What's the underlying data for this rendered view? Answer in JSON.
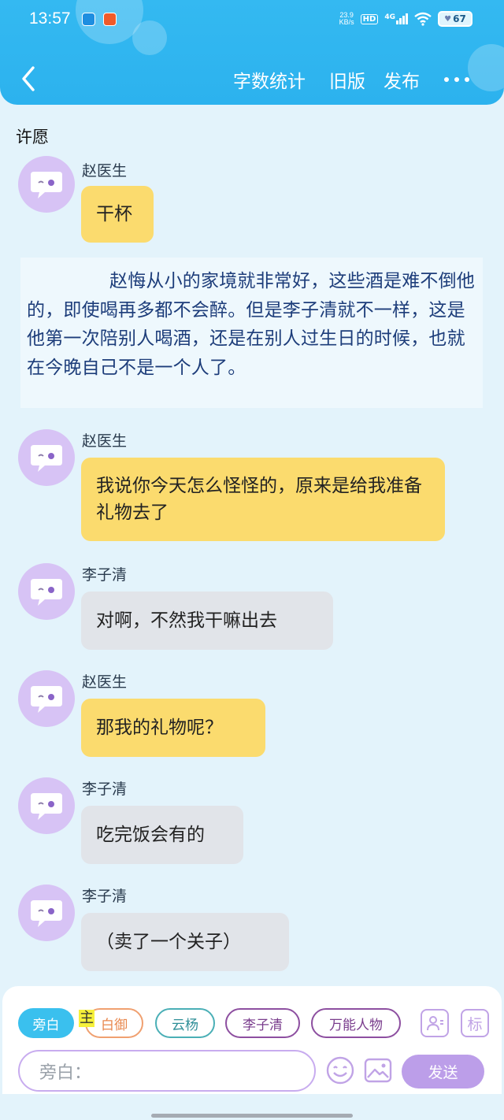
{
  "status_bar": {
    "time": "13:57",
    "net_speed_value": "23.9",
    "net_speed_unit": "KB/s",
    "hd": "HD",
    "network": "4G",
    "battery": "67"
  },
  "nav": {
    "word_count": "字数统计",
    "old_version": "旧版",
    "publish": "发布"
  },
  "novel_title": "许愿",
  "messages": [
    {
      "sender": "赵医生",
      "text": "干杯",
      "style": "yellow"
    },
    {
      "sender": "赵医生",
      "text": "我说你今天怎么怪怪的，原来是给我准备礼物去了",
      "style": "yellow"
    },
    {
      "sender": "李子清",
      "text": "对啊，不然我干嘛出去",
      "style": "gray"
    },
    {
      "sender": "赵医生",
      "text": "那我的礼物呢？",
      "style": "yellow"
    },
    {
      "sender": "李子清",
      "text": "吃完饭会有的",
      "style": "gray"
    },
    {
      "sender": "李子清",
      "text": "（卖了一个关子）",
      "style": "gray"
    }
  ],
  "narration": "赵悔从小的家境就非常好，这些酒是难不倒他的，即使喝再多都不会醉。但是李子清就不一样，这是他第一次陪别人喝酒，还是在别人过生日的时候，也就在今晚自己不是一个人了。",
  "composer": {
    "roles": [
      "旁白",
      "白御",
      "云杨",
      "李子清",
      "万能人物"
    ],
    "active_role": "旁白",
    "main_mark": "主",
    "label_button": "标",
    "input_placeholder": "旁白：",
    "send": "发送"
  },
  "colors": {
    "header": "#2cb2ee",
    "yellow_bubble": "#fbdb6e",
    "gray_bubble": "#e1e4e9",
    "accent_purple": "#bc9ee9"
  }
}
